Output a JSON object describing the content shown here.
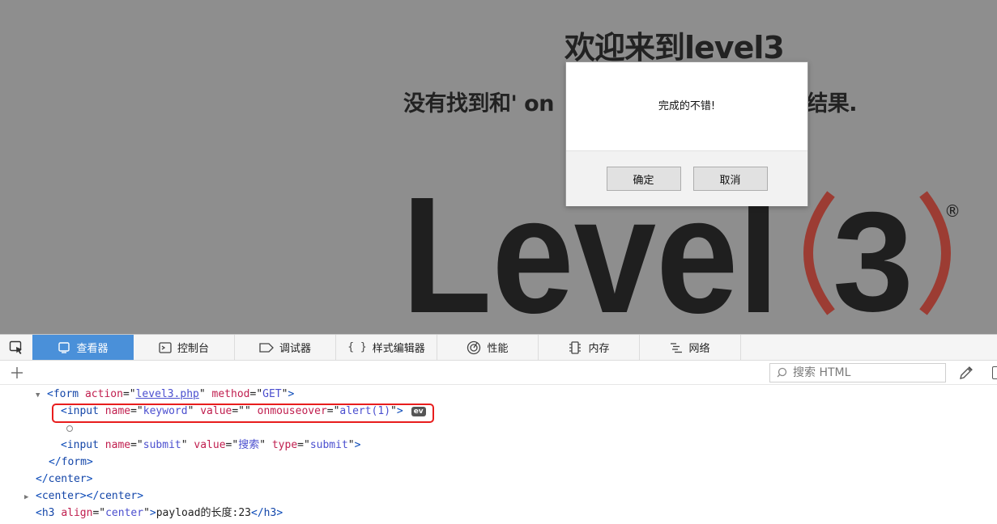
{
  "page": {
    "title": "欢迎来到level3",
    "result_prefix": "没有找到和' on",
    "result_suffix": ")相关的结果.",
    "logo": {
      "word": "Level",
      "number": "3",
      "registered": "®"
    }
  },
  "dialog": {
    "message": "完成的不错!",
    "ok_label": "确定",
    "cancel_label": "取消"
  },
  "devtools": {
    "tabs": [
      {
        "label": "查看器",
        "icon": "inspector-icon",
        "active": true
      },
      {
        "label": "控制台",
        "icon": "console-icon",
        "active": false
      },
      {
        "label": "调试器",
        "icon": "debugger-icon",
        "active": false
      },
      {
        "label": "样式编辑器",
        "icon": "style-editor-icon",
        "active": false
      },
      {
        "label": "性能",
        "icon": "performance-icon",
        "active": false
      },
      {
        "label": "内存",
        "icon": "memory-icon",
        "active": false
      },
      {
        "label": "网络",
        "icon": "network-icon",
        "active": false
      }
    ],
    "search_placeholder": "搜索 HTML",
    "markup": {
      "form_tag": "form",
      "form_action_attr": "action",
      "form_action_val": "level3.php",
      "form_method_attr": "method",
      "form_method_val": "GET",
      "input_tag": "input",
      "name_attr": "name",
      "value_attr": "value",
      "type_attr": "type",
      "input1_name": "keyword",
      "input1_value": "",
      "input1_event_attr": "onmouseover",
      "input1_event_val": "alert(1)",
      "ev_badge": "ev",
      "input2_name": "submit",
      "input2_value": "搜索",
      "input2_type": "submit",
      "center_tag": "center",
      "h3_tag": "h3",
      "h3_align_attr": "align",
      "h3_align_val": "center",
      "h3_text": "payload的长度:23"
    },
    "colors": {
      "active_tab": "#4a90d9",
      "highlight_box": "#e81d1d"
    }
  }
}
